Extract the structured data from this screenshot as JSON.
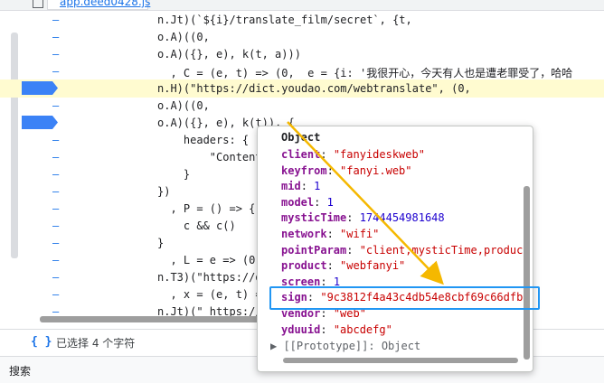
{
  "tab": {
    "filename": "app.deed0428.js"
  },
  "code_lines": [
    {
      "text": "n.Jt)(`${i}/translate_film/secret`, {t,",
      "highlight": false,
      "breakpoint": false
    },
    {
      "text": "o.A)((0,",
      "highlight": false,
      "breakpoint": false
    },
    {
      "text": "o.A)({}, e), k(t, a)))",
      "highlight": false,
      "breakpoint": false
    },
    {
      "text": "  , C = (e, t) => (0,  e = {i: '我很开心，今天有人也是遭老罪受了，哈哈",
      "highlight": false,
      "breakpoint": false
    },
    {
      "text": "n.H)(\"https://dict.youdao.com/webtranslate\", (0,",
      "highlight": true,
      "breakpoint": true
    },
    {
      "text": "o.A)((0,",
      "highlight": false,
      "breakpoint": false
    },
    {
      "text": "o.A)({}, e), k(t)), {",
      "highlight": false,
      "breakpoint": true
    },
    {
      "text": "    headers: {",
      "highlight": false,
      "breakpoint": false
    },
    {
      "text": "        \"Content",
      "highlight": false,
      "breakpoint": false
    },
    {
      "text": "    }",
      "highlight": false,
      "breakpoint": false
    },
    {
      "text": "})",
      "highlight": false,
      "breakpoint": false
    },
    {
      "text": "  , P = () => {",
      "highlight": false,
      "breakpoint": false
    },
    {
      "text": "    c && c()",
      "highlight": false,
      "breakpoint": false
    },
    {
      "text": "}",
      "highlight": false,
      "breakpoint": false
    },
    {
      "text": "  , L = e => (0,",
      "highlight": false,
      "breakpoint": false
    },
    {
      "text": "n.T3)(\"https://d",
      "highlight": false,
      "breakpoint": false
    },
    {
      "text": "  , x = (e, t) =",
      "highlight": false,
      "breakpoint": false
    },
    {
      "text": "n.Jt)(\" https://",
      "highlight": false,
      "breakpoint": false
    }
  ],
  "status": {
    "braces": "{ }",
    "selection_info": "已选择 4 个字符"
  },
  "search": {
    "label": "搜索"
  },
  "popup": {
    "title": "Object",
    "props": [
      {
        "key": "client",
        "value": "\"fanyideskweb\"",
        "type": "string"
      },
      {
        "key": "keyfrom",
        "value": "\"fanyi.web\"",
        "type": "string"
      },
      {
        "key": "mid",
        "value": "1",
        "type": "number"
      },
      {
        "key": "model",
        "value": "1",
        "type": "number"
      },
      {
        "key": "mysticTime",
        "value": "1744454981648",
        "type": "number"
      },
      {
        "key": "network",
        "value": "\"wifi\"",
        "type": "string"
      },
      {
        "key": "pointParam",
        "value": "\"client,mysticTime,produc",
        "type": "string"
      },
      {
        "key": "product",
        "value": "\"webfanyi\"",
        "type": "string"
      },
      {
        "key": "screen",
        "value": "1",
        "type": "number"
      },
      {
        "key": "sign",
        "value": "\"9c3812f4a43c4db54e8cbf69c66dfb",
        "type": "string"
      },
      {
        "key": "vendor",
        "value": "\"web\"",
        "type": "string"
      },
      {
        "key": "yduuid",
        "value": "\"abcdefg\"",
        "type": "string"
      }
    ],
    "prototype": "[[Prototype]]: Object"
  },
  "colors": {
    "highlight": "#fffbd0",
    "breakpoint": "#3b82f6",
    "annotation_box": "#2196f3",
    "arrow": "#f5b800"
  }
}
